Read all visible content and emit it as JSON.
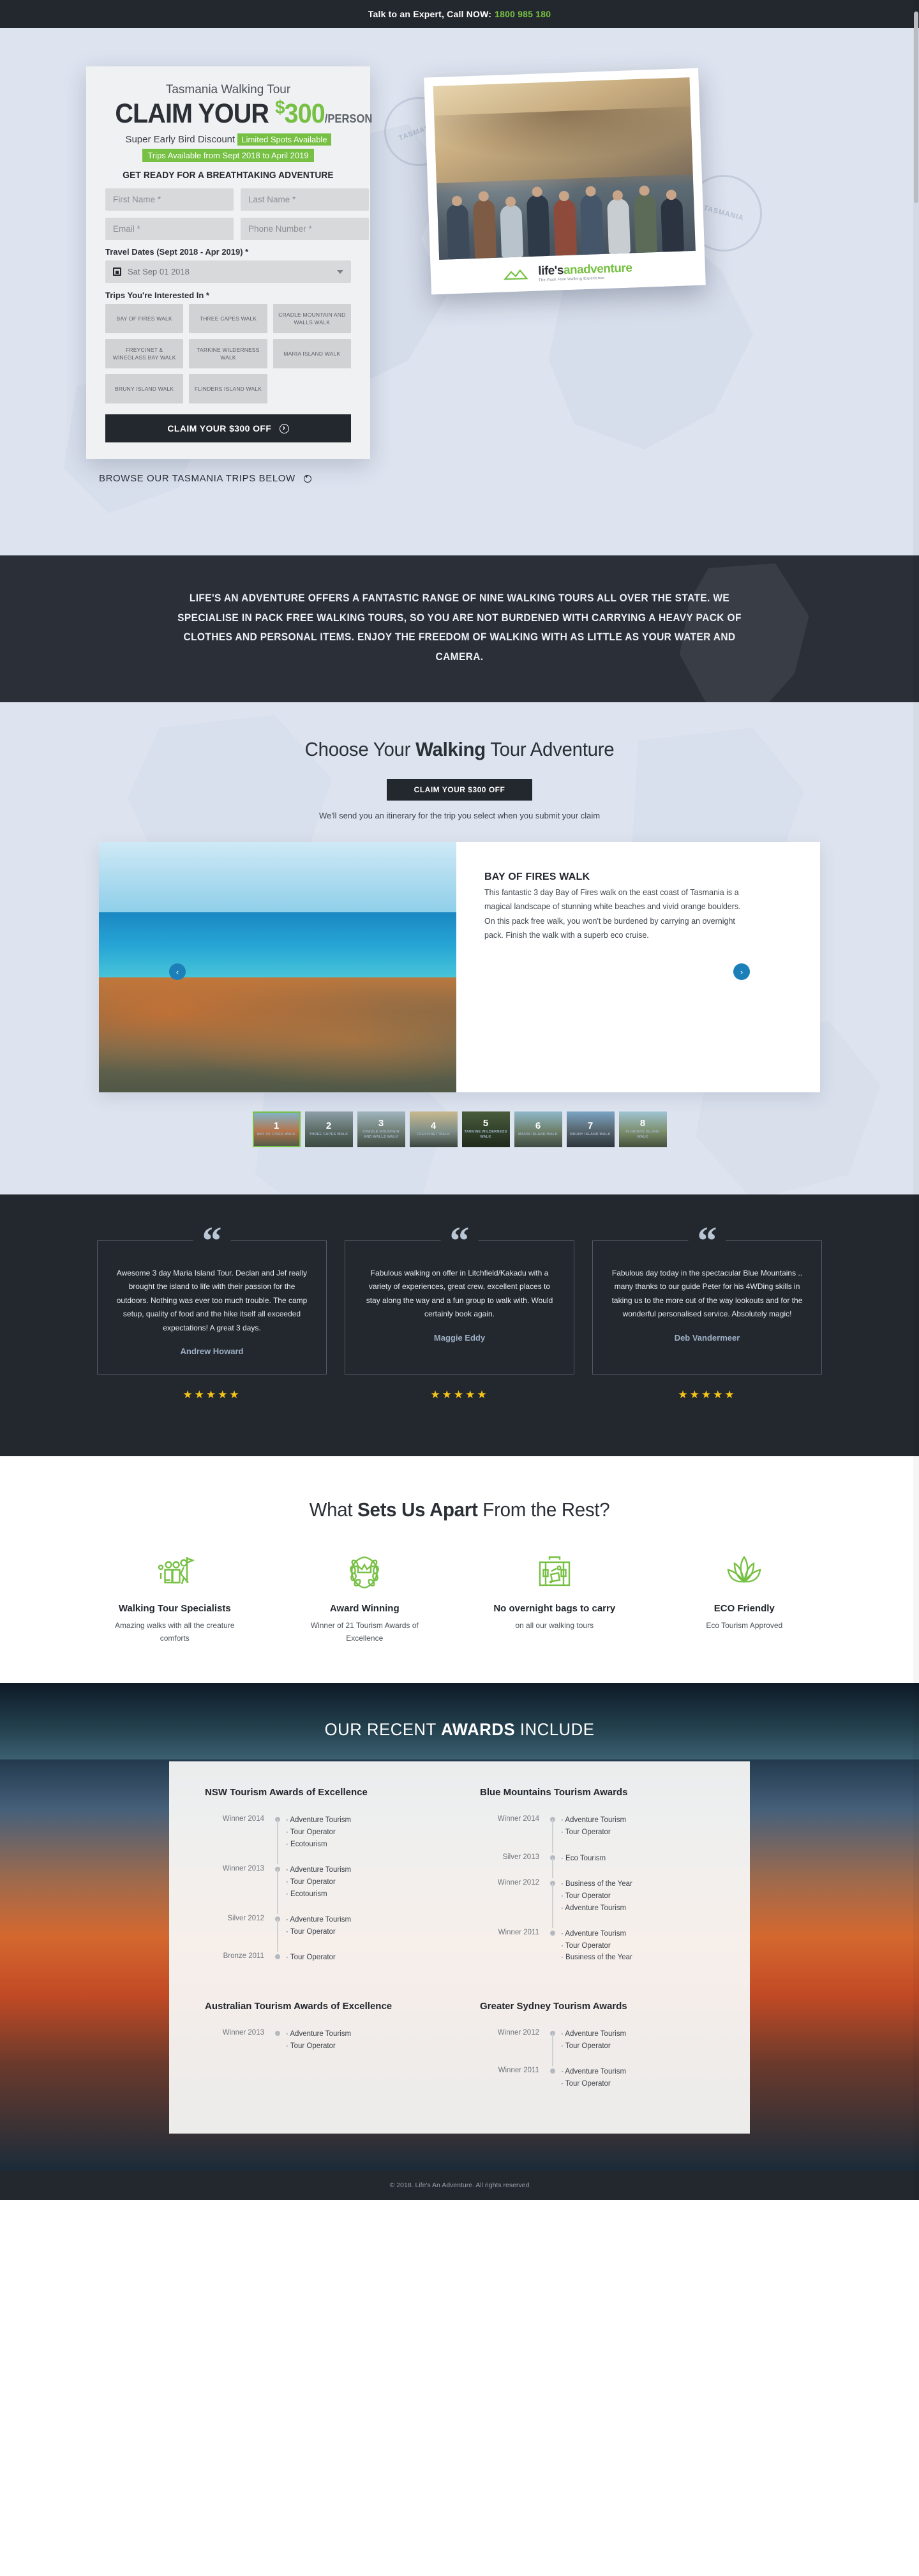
{
  "topbar": {
    "text": "Talk to an Expert, Call NOW:",
    "phone": "1800 985 180",
    "phone_color": "#76c043"
  },
  "hero": {
    "form": {
      "kicker": "Tasmania Walking Tour",
      "headline_prefix": "CLAIM YOUR",
      "headline_dollar": "$",
      "headline_price": "300",
      "headline_per": "/PERSON",
      "sub_text": "Super Early Bird Discount",
      "sub_badge": "Limited Spots Available",
      "availability_badge": "Trips Available from Sept 2018 to April 2019",
      "ready_line": "GET READY FOR A BREATHTAKING ADVENTURE",
      "first_name_placeholder": "First Name *",
      "last_name_placeholder": "Last Name *",
      "email_placeholder": "Email *",
      "phone_placeholder": "Phone Number *",
      "travel_dates_label": "Travel Dates (Sept 2018 - Apr 2019) *",
      "travel_dates_value": "Sat Sep 01 2018",
      "trips_label": "Trips You're Interested In *",
      "trip_options": [
        "BAY OF FIRES WALK",
        "THREE CAPES WALK",
        "CRADLE MOUNTAIN AND WALLS WALK",
        "FREYCINET & WINEGLASS BAY WALK",
        "TARKINE WILDERNESS WALK",
        "MARIA ISLAND WALK",
        "BRUNY ISLAND WALK",
        "FLINDERS ISLAND WALK"
      ],
      "submit_label": "CLAIM YOUR $300 OFF"
    },
    "browse_label": "BROWSE OUR TASMANIA TRIPS BELOW",
    "stamp_left": "TASMANIA",
    "stamp_right": "TASMANIA",
    "logo_text_1": "life's",
    "logo_text_2": "an",
    "logo_text_3": "adventure",
    "logo_tagline": "The Pack Free Walking Experience"
  },
  "intro": {
    "text": "LIFE'S AN ADVENTURE OFFERS A FANTASTIC RANGE OF NINE WALKING TOURS ALL OVER THE STATE. WE SPECIALISE IN PACK FREE WALKING TOURS, SO YOU ARE NOT BURDENED WITH CARRYING A HEAVY PACK OF CLOTHES AND PERSONAL ITEMS. ENJOY THE FREEDOM OF WALKING WITH AS LITTLE AS YOUR WATER AND CAMERA."
  },
  "choose": {
    "title_prefix": "Choose Your ",
    "title_bold": "Walking",
    "title_suffix": " Tour Adventure",
    "cta_label": "CLAIM YOUR $300 OFF",
    "note": "We'll send you an itinerary for the trip you select when you submit your claim",
    "slide": {
      "title": "BAY OF FIRES WALK",
      "desc": "This fantastic 3 day Bay of Fires walk on the east coast of Tasmania is a magical landscape of stunning white beaches and vivid orange boulders. On this pack free walk, you won't be burdened by carrying an overnight pack. Finish the walk with a superb eco cruise."
    },
    "prev_arrow": "‹",
    "next_arrow": "›",
    "thumbnails": [
      {
        "num": "1",
        "name": "BAY OF FIRES WALK"
      },
      {
        "num": "2",
        "name": "THREE CAPES WALK"
      },
      {
        "num": "3",
        "name": "CRADLE MOUNTAIN AND WALLS WALK"
      },
      {
        "num": "4",
        "name": "FREYCINET WALK"
      },
      {
        "num": "5",
        "name": "TARKINE WILDERNESS WALK"
      },
      {
        "num": "6",
        "name": "MARIA ISLAND WALK"
      },
      {
        "num": "7",
        "name": "BRUNY ISLAND WALK"
      },
      {
        "num": "8",
        "name": "FLINDERS ISLAND WALK"
      }
    ]
  },
  "testimonials": [
    {
      "quote": "Awesome 3 day Maria Island Tour. Declan and Jef really brought the island to life with their passion for the outdoors. Nothing was ever too much trouble. The camp setup, quality of food and the hike itself all exceeded expectations! A great 3 days.",
      "name": "Andrew Howard",
      "stars": "★★★★★"
    },
    {
      "quote": "Fabulous walking on offer in Litchfield/Kakadu with a variety of experiences, great crew, excellent places to stay along the way and a fun group to walk with. Would certainly book again.",
      "name": "Maggie Eddy",
      "stars": "★★★★★"
    },
    {
      "quote": "Fabulous day today in the spectacular Blue Mountains .. many thanks to our guide Peter for his 4WDing skills in taking us to the more out of the way lookouts and for the wonderful personalised service. Absolutely magic!",
      "name": "Deb Vandermeer",
      "stars": "★★★★★"
    }
  ],
  "apart": {
    "title_prefix": "What ",
    "title_bold": "Sets Us Apart",
    "title_suffix": " From the Rest?",
    "features": [
      {
        "icon": "walking-group-icon",
        "title": "Walking Tour Specialists",
        "desc": "Amazing walks with all the creature comforts"
      },
      {
        "icon": "laurel-crown-icon",
        "title": "Award Winning",
        "desc": "Winner of 21 Tourism Awards of Excellence"
      },
      {
        "icon": "suitcase-icon",
        "title": "No overnight bags to carry",
        "desc": "on all our walking tours"
      },
      {
        "icon": "lotus-leaf-icon",
        "title": "ECO Friendly",
        "desc": "Eco Tourism Approved"
      }
    ]
  },
  "awards": {
    "title_prefix": "OUR RECENT ",
    "title_bold": "AWARDS",
    "title_suffix": " INCLUDE",
    "groups": [
      {
        "heading": "NSW Tourism Awards of Excellence",
        "rows": [
          {
            "when": "Winner 2014",
            "items": [
              "· Adventure Tourism",
              "· Tour Operator",
              "· Ecotourism"
            ]
          },
          {
            "when": "Winner 2013",
            "items": [
              "· Adventure Tourism",
              "· Tour Operator",
              "· Ecotourism"
            ]
          },
          {
            "when": "Silver 2012",
            "items": [
              "· Adventure Tourism",
              "· Tour Operator"
            ]
          },
          {
            "when": "Bronze 2011",
            "items": [
              "· Tour Operator"
            ]
          }
        ]
      },
      {
        "heading": "Blue Mountains Tourism Awards",
        "rows": [
          {
            "when": "Winner 2014",
            "items": [
              "· Adventure Tourism",
              "· Tour Operator"
            ]
          },
          {
            "when": "Silver 2013",
            "items": [
              "· Eco Tourism"
            ]
          },
          {
            "when": "Winner 2012",
            "items": [
              "· Business of the Year",
              "· Tour Operator",
              "· Adventure Tourism"
            ]
          },
          {
            "when": "Winner 2011",
            "items": [
              "· Adventure Tourism",
              "· Tour Operator",
              "· Business of the Year"
            ]
          }
        ]
      },
      {
        "heading": "Australian Tourism Awards of Excellence",
        "rows": [
          {
            "when": "Winner 2013",
            "items": [
              "· Adventure Tourism",
              "· Tour Operator"
            ]
          }
        ]
      },
      {
        "heading": "Greater Sydney Tourism Awards",
        "rows": [
          {
            "when": "Winner 2012",
            "items": [
              "· Adventure Tourism",
              "· Tour Operator"
            ]
          },
          {
            "when": "Winner 2011",
            "items": [
              "· Adventure Tourism",
              "· Tour Operator"
            ]
          }
        ]
      }
    ]
  },
  "footer": {
    "text": "© 2018. Life's An Adventure. All rights reserved"
  }
}
